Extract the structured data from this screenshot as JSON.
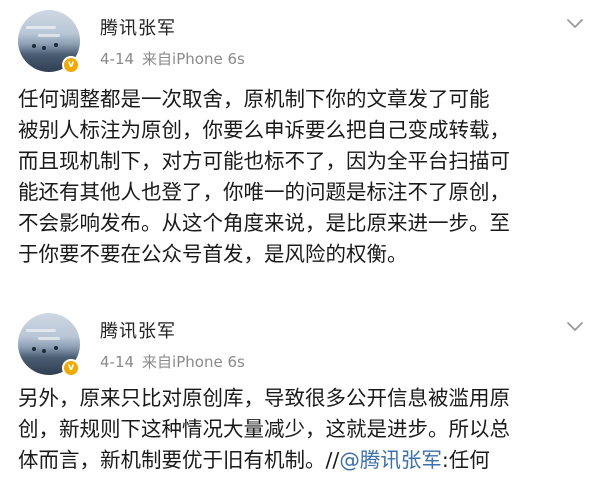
{
  "posts": [
    {
      "author": "腾讯张军",
      "date": "4-14",
      "source": "来自iPhone 6s",
      "lines": [
        "任何调整都是一次取舍，原机制下你的文章发了可能",
        "被别人标注为原创，你要么申诉要么把自己变成转载，",
        "而且现机制下，对方可能也标不了，因为全平台扫描可",
        "能还有其他人也登了，你唯一的问题是标注不了原创，",
        "不会影响发布。从这个角度来说，是比原来进一步。至",
        "于你要不要在公众号首发，是风险的权衡。"
      ]
    },
    {
      "author": "腾讯张军",
      "date": "4-14",
      "source": "来自iPhone 6s",
      "lines": [
        "另外，原来只比对原创库，导致很多公开信息被滥用原",
        "创，新规则下这种情况大量减少，这就是进步。所以总"
      ],
      "last_line_prefix": "体而言，新机制要优于旧有机制。//",
      "mention": "@腾讯张军",
      "last_line_suffix": ":任何"
    }
  ],
  "icons": {
    "verified": "verified-badge-icon",
    "menu": "chevron-down-icon"
  },
  "colors": {
    "verified_badge": "#f2a900",
    "mention": "#3b6fb0",
    "meta_text": "#8a8a8a"
  }
}
